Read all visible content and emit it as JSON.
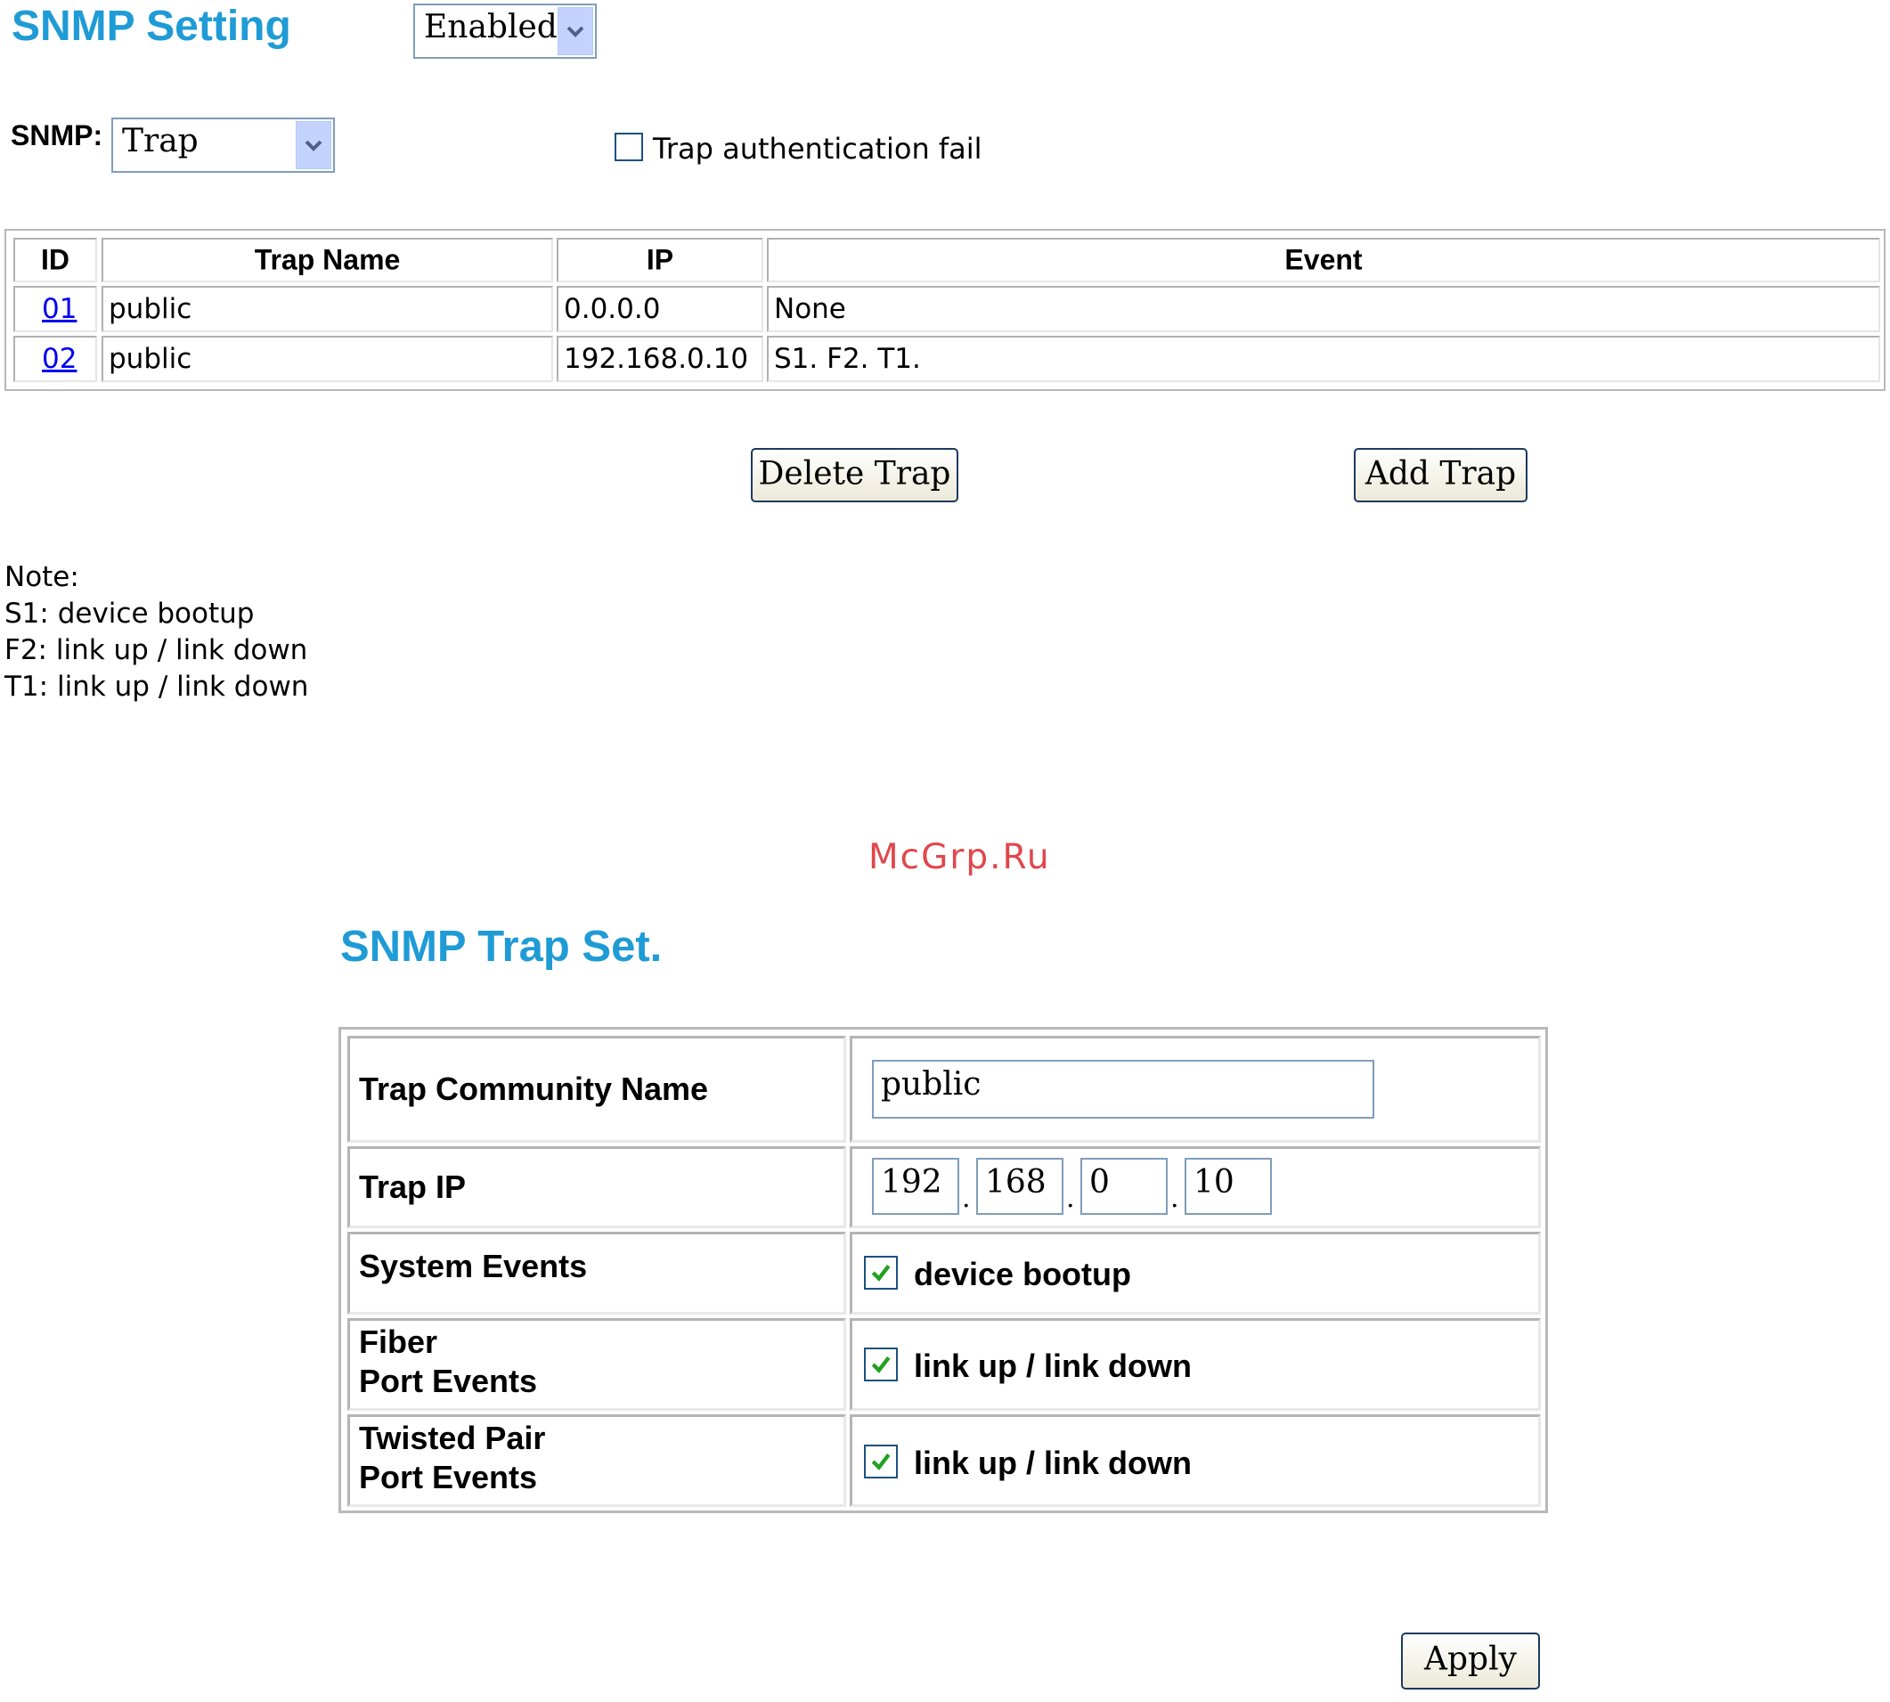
{
  "snmp_setting": {
    "title": "SNMP Setting",
    "status_select": "Enabled",
    "snmp_label": "SNMP:",
    "mode_select": "Trap",
    "auth_fail_label": "Trap authentication fail",
    "auth_fail_checked": false
  },
  "trap_table": {
    "headers": [
      "ID",
      "Trap Name",
      "IP",
      "Event"
    ],
    "rows": [
      {
        "id": "01",
        "name": "public",
        "ip": "0.0.0.0",
        "event": "None"
      },
      {
        "id": "02",
        "name": "public",
        "ip": "192.168.0.10",
        "event": "S1. F2. T1."
      }
    ]
  },
  "buttons": {
    "delete": "Delete Trap",
    "add": "Add Trap",
    "apply": "Apply"
  },
  "note": {
    "title": "Note:",
    "lines": [
      "S1: device bootup",
      "F2: link up / link down",
      "T1: link up / link down"
    ]
  },
  "watermark": "McGrp.Ru",
  "trap_set": {
    "title": "SNMP Trap Set.",
    "community_label": "Trap Community Name",
    "community_value": "public",
    "ip_label": "Trap IP",
    "ip_octets": [
      "192",
      "168",
      "0",
      "10"
    ],
    "ip_separator": ".",
    "system_events_label": "System Events",
    "system_events_option": "device bootup",
    "fiber_label_line1": "Fiber",
    "fiber_label_line2": "Port Events",
    "fiber_option": "link up / link down",
    "tp_label_line1": "Twisted Pair",
    "tp_label_line2": "Port Events",
    "tp_option": "link up / link down",
    "checked_color": "#21a121"
  }
}
